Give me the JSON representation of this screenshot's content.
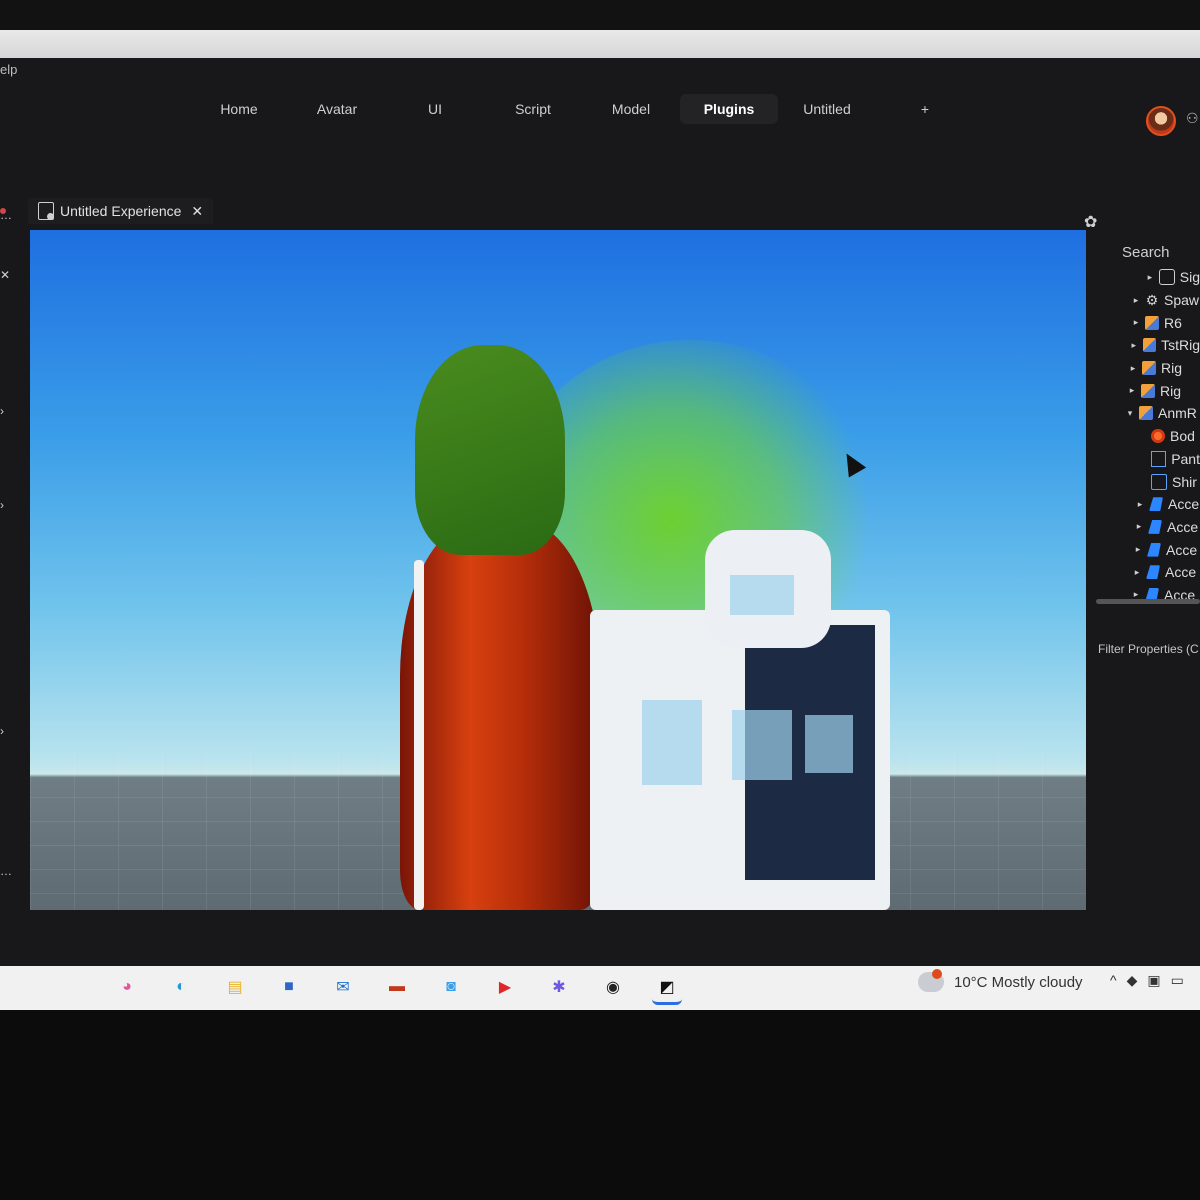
{
  "menu": {
    "help_fragment": "elp"
  },
  "ribbon": {
    "tabs": [
      {
        "label": "Home"
      },
      {
        "label": "Avatar"
      },
      {
        "label": "UI"
      },
      {
        "label": "Script"
      },
      {
        "label": "Model"
      },
      {
        "label": "Plugins",
        "active": true
      },
      {
        "label": "Untitled"
      },
      {
        "label": "+"
      }
    ]
  },
  "document_tab": {
    "title": "Untitled Experience",
    "close_symbol": "✕"
  },
  "explorer": {
    "search_label": "Search",
    "items": [
      {
        "label": "Sig",
        "icon": "spawn-icon"
      },
      {
        "label": "Spaw",
        "icon": "gear-icon"
      },
      {
        "label": "R6",
        "icon": "model-icon"
      },
      {
        "label": "TstRig",
        "icon": "model-icon"
      },
      {
        "label": "Rig",
        "icon": "model-icon"
      },
      {
        "label": "Rig",
        "icon": "model-icon"
      },
      {
        "label": "AnmR",
        "icon": "model-icon",
        "expanded": true
      },
      {
        "label": "Bod",
        "icon": "body-colors-icon"
      },
      {
        "label": "Pant",
        "icon": "pants-icon"
      },
      {
        "label": "Shir",
        "icon": "shirt-icon"
      },
      {
        "label": "Acce",
        "icon": "accessory-icon"
      },
      {
        "label": "Acce",
        "icon": "accessory-icon"
      },
      {
        "label": "Acce",
        "icon": "accessory-icon"
      },
      {
        "label": "Acce",
        "icon": "accessory-icon"
      },
      {
        "label": "Acce",
        "icon": "accessory-icon"
      }
    ]
  },
  "properties": {
    "filter_label": "Filter Properties (C"
  },
  "taskbar": {
    "apps": [
      {
        "name": "copilot-icon",
        "glyph": "◕",
        "color": "#e0559b"
      },
      {
        "name": "edge-icon",
        "glyph": "◐",
        "color": "#1f9ad6"
      },
      {
        "name": "file-explorer-icon",
        "glyph": "▤",
        "color": "#e8b42a"
      },
      {
        "name": "store-icon",
        "glyph": "■",
        "color": "#2f64c8"
      },
      {
        "name": "outlook-icon",
        "glyph": "✉",
        "color": "#1a6fcf"
      },
      {
        "name": "app-icon",
        "glyph": "▬",
        "color": "#c0391b"
      },
      {
        "name": "chat-icon",
        "glyph": "◙",
        "color": "#3a9ee8"
      },
      {
        "name": "youtube-icon",
        "glyph": "▶",
        "color": "#e02626"
      },
      {
        "name": "loop-icon",
        "glyph": "✱",
        "color": "#6b5ae0"
      },
      {
        "name": "obs-icon",
        "glyph": "◉",
        "color": "#222222"
      },
      {
        "name": "roblox-studio-icon",
        "glyph": "◩",
        "color": "#111111",
        "active": true
      }
    ],
    "weather": "10°C  Mostly cloudy",
    "tray": [
      {
        "name": "chevron-up-icon",
        "glyph": "^"
      },
      {
        "name": "tray-app-icon",
        "glyph": "◆"
      },
      {
        "name": "camera-icon",
        "glyph": "▣"
      },
      {
        "name": "network-icon",
        "glyph": "▭"
      }
    ]
  }
}
